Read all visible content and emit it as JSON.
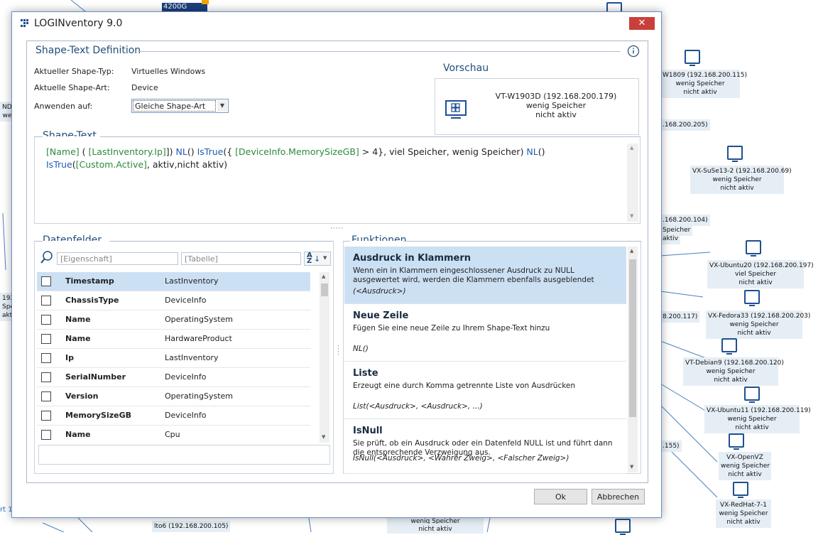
{
  "window": {
    "title": "LOGINventory 9.0",
    "close_label": "✕"
  },
  "background": {
    "tag_4200g": "4200G",
    "nodes": [
      {
        "label": "W1809 (192.168.200.115)\nwenig Speicher\nnicht aktiv"
      },
      {
        "label": "VX-SuSe13-2 (192.168.200.69)\nwenig Speicher\nnicht aktiv"
      },
      {
        "label": "VX-Ubuntu20 (192.168.200.197)\nviel Speicher\nnicht aktiv"
      },
      {
        "label": "VX-Fedora33 (192.168.200.203)\nwenig Speicher\nnicht aktiv"
      },
      {
        "label": "VT-Debian9 (192.168.200.120)\nwenig Speicher\nnicht aktiv"
      },
      {
        "label": "VX-Ubuntu11 (192.168.200.119)\nwenig Speicher\nnicht aktiv"
      },
      {
        "label": "VX-OpenVZ\nwenig Speicher\nnicht aktiv"
      },
      {
        "label": "VX-RedHat-7-1\nwenig Speicher\nnicht aktiv"
      }
    ],
    "partial_texts": [
      ".168.200.205)",
      ".168.200.104)",
      "Speicher",
      "aktiv",
      "8.200.117)",
      ".155)",
      "lto6 (192.168.200.105)",
      "wenig Speicher",
      "nicht aktiv",
      "NDE",
      "we",
      "192.",
      "Spei",
      "akti",
      "rt 1"
    ]
  },
  "definition": {
    "section_title": "Shape-Text Definition",
    "info_icon": "info-icon",
    "shape_type_label": "Aktueller Shape-Typ:",
    "shape_type_value": "Virtuelles Windows",
    "shape_art_label": "Aktuelle Shape-Art:",
    "shape_art_value": "Device",
    "apply_label": "Anwenden auf:",
    "apply_value": "Gleiche Shape-Art"
  },
  "preview": {
    "title": "Vorschau",
    "line1": "VT-W1903D (192.168.200.179)",
    "line2": "wenig Speicher",
    "line3": "nicht aktiv"
  },
  "shape_text": {
    "title": "Shape-Text",
    "line1": [
      {
        "t": "[Name]",
        "c": "fld"
      },
      {
        "t": " ( ",
        "c": ""
      },
      {
        "t": "[LastInventory.Ip]",
        "c": "fld"
      },
      {
        "t": "]) ",
        "c": ""
      },
      {
        "t": "NL",
        "c": "fn"
      },
      {
        "t": "() ",
        "c": ""
      },
      {
        "t": "IsTrue",
        "c": "fn"
      },
      {
        "t": "({ ",
        "c": ""
      },
      {
        "t": "[DeviceInfo.MemorySizeGB]",
        "c": "fld"
      },
      {
        "t": " > 4}, viel Speicher, wenig Speicher) ",
        "c": ""
      },
      {
        "t": "NL",
        "c": "fn"
      },
      {
        "t": "()",
        "c": ""
      }
    ],
    "line2": [
      {
        "t": "IsTrue",
        "c": "fn"
      },
      {
        "t": "(",
        "c": ""
      },
      {
        "t": "[Custom.Active]",
        "c": "fld"
      },
      {
        "t": ", aktiv,nicht aktiv)",
        "c": ""
      }
    ]
  },
  "datenfelder": {
    "title": "Datenfelder",
    "property_placeholder": "[Eigenschaft]",
    "table_placeholder": "[Tabelle]",
    "rows": [
      {
        "name": "Timestamp",
        "table": "LastInventory",
        "icon": "calendar-icon",
        "selected": true
      },
      {
        "name": "ChassisType",
        "table": "DeviceInfo",
        "icon": "window-icon"
      },
      {
        "name": "Name",
        "table": "OperatingSystem",
        "icon": "os-icon"
      },
      {
        "name": "Name",
        "table": "HardwareProduct",
        "icon": "laptop-icon"
      },
      {
        "name": "Ip",
        "table": "LastInventory",
        "icon": "calendar-icon"
      },
      {
        "name": "SerialNumber",
        "table": "DeviceInfo",
        "icon": "window-icon"
      },
      {
        "name": "Version",
        "table": "OperatingSystem",
        "icon": "os-icon"
      },
      {
        "name": "MemorySizeGB",
        "table": "DeviceInfo",
        "icon": "window-icon"
      },
      {
        "name": "Name",
        "table": "Cpu",
        "icon": "cpu-icon"
      }
    ]
  },
  "funktionen": {
    "title": "Funktionen",
    "items": [
      {
        "title": "Ausdruck in Klammern",
        "desc": "Wenn ein in Klammern eingeschlossener Ausdruck zu NULL ausgewertet wird, werden die Klammern ebenfalls ausgeblendet",
        "syntax": "(<Ausdruck>)"
      },
      {
        "title": "Neue Zeile",
        "desc": "Fügen Sie eine neue Zeile zu Ihrem Shape-Text hinzu",
        "syntax": "NL()"
      },
      {
        "title": "Liste",
        "desc": "Erzeugt eine durch Komma getrennte Liste von Ausdrücken",
        "syntax": "List(<Ausdruck>, <Ausdruck>, ...)"
      },
      {
        "title": "IsNull",
        "desc": "Sie prüft, ob ein Ausdruck oder ein Datenfeld NULL ist und führt dann die entsprechende Verzweigung aus.",
        "syntax": "IsNull(<Ausdruck>, <Wahrer Zweig>, <Falscher Zweig>)"
      }
    ]
  },
  "buttons": {
    "ok": "Ok",
    "cancel": "Abbrechen"
  }
}
